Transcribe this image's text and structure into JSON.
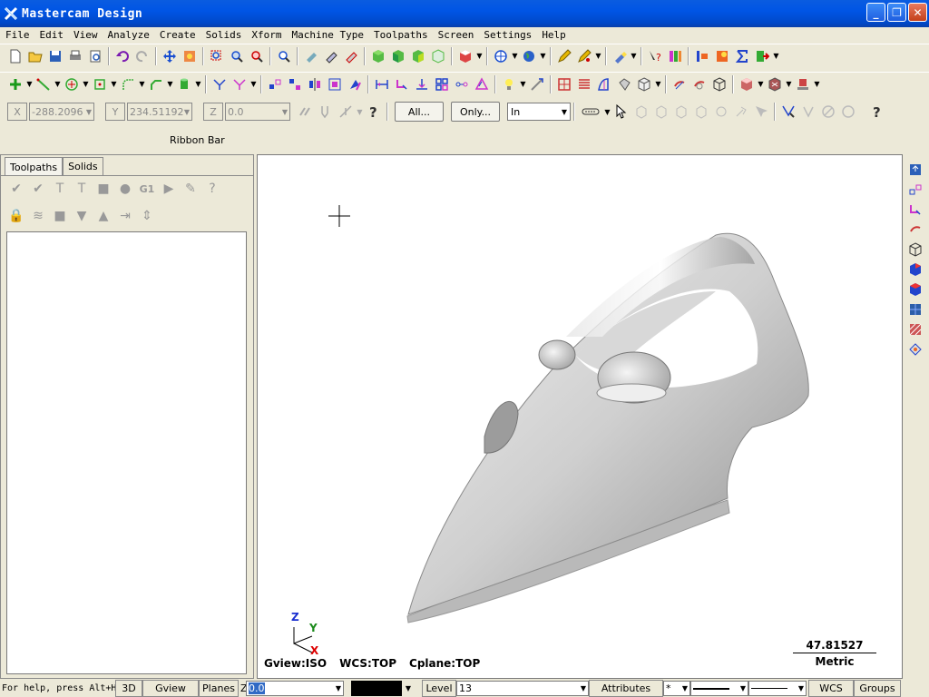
{
  "window": {
    "title": "Mastercam Design",
    "minimize": "_",
    "maximize": "❐",
    "close": "✕"
  },
  "menu": [
    "File",
    "Edit",
    "View",
    "Analyze",
    "Create",
    "Solids",
    "Xform",
    "Machine Type",
    "Toolpaths",
    "Screen",
    "Settings",
    "Help"
  ],
  "ribbon": {
    "x_label": "X",
    "x_value": "-288.2096",
    "y_label": "Y",
    "y_value": "234.51192",
    "z_label": "Z",
    "z_value": "0.0",
    "all_button": "All...",
    "only_button": "Only...",
    "mode_value": "In",
    "title": "Ribbon Bar"
  },
  "manager": {
    "tabs": [
      "Toolpaths",
      "Solids"
    ],
    "op_g1": "G1"
  },
  "viewport": {
    "gview": "Gview:ISO",
    "wcs": "WCS:TOP",
    "cplane": "Cplane:TOP",
    "scale_value": "47.81527",
    "scale_unit": "Metric",
    "axis_z": "Z",
    "axis_y": "Y",
    "axis_x": "X"
  },
  "status": {
    "help": "For help, press Alt+H",
    "btn_3d": "3D",
    "gview": "Gview",
    "planes": "Planes",
    "z_label": "Z",
    "z_value": "0.0",
    "level_label": "Level",
    "level_value": "13",
    "attributes": "Attributes",
    "point_style": "*",
    "wcs": "WCS",
    "groups": "Groups"
  },
  "colors": {
    "title_bar": "#0054e3",
    "panel": "#ece9d8",
    "viewport_bg": "#ffffff"
  }
}
